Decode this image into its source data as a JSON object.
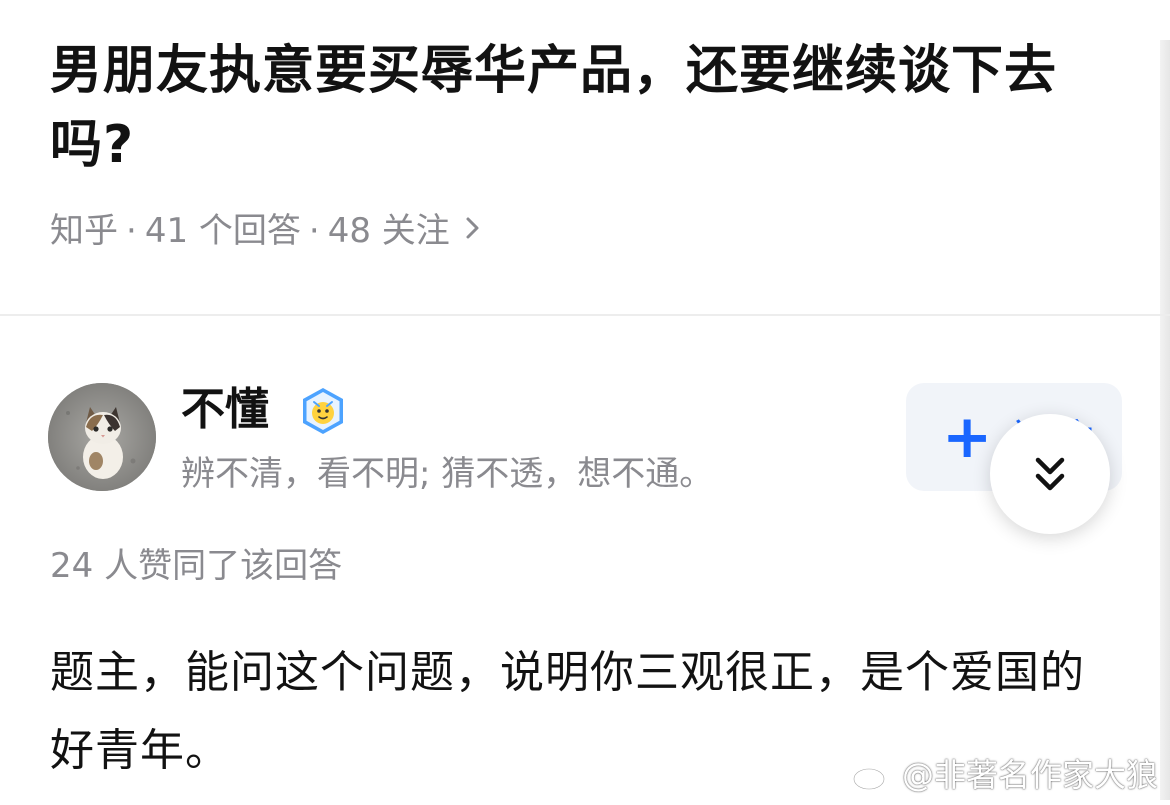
{
  "question": {
    "title": "男朋友执意要买辱华产品，还要继续谈下去吗?",
    "source": "知乎",
    "separator": "·",
    "answer_count": "41 个回答",
    "follower_count": "48 关注",
    "chevron_icon": "chevron-right-icon"
  },
  "answer": {
    "author": {
      "name": "不懂",
      "bio": "辨不清，看不明; 猜不透，想不通。",
      "avatar_icon": "cat-avatar",
      "badge_icon": "verified-badge-icon"
    },
    "follow_button": {
      "label": "关注",
      "icon": "plus-icon",
      "color": "#1a66ff"
    },
    "vote_text": "24 人赞同了该回答",
    "content": "题主，能问这个问题，说明你三观很正，是个爱国的好青年。"
  },
  "expand_button_icon": "double-chevron-down-icon",
  "watermark": {
    "text": "@非著名作家大狼",
    "icon": "weibo-icon"
  },
  "colors": {
    "text_primary": "#121212",
    "text_secondary": "#8a8a8f",
    "accent": "#1a66ff",
    "button_bg": "#f1f4f9"
  }
}
